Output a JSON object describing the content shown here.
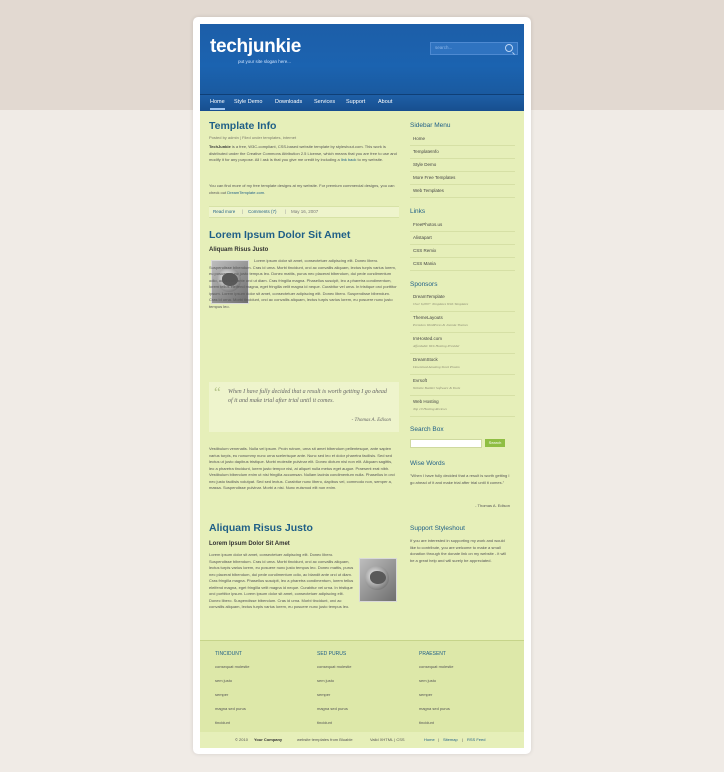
{
  "site": {
    "logo": "techjunkie",
    "slogan": "put your site slogan here...",
    "search_placeholder": "search..."
  },
  "nav": [
    "Home",
    "Style Demo",
    "Downloads",
    "Services",
    "Support",
    "About"
  ],
  "main": {
    "post1": {
      "title": "Template Info",
      "meta": "Posted by admin | Filed under templates, internet",
      "p1_strong": "TechJunkie",
      "p1": " is a free, W3C-compliant, CSS-based website template by styleshout.com. This work is distributed under the Creative Commons Attribution 2.5 License, which means that you are free to use and modify it for any purpose. All I ask is that you give me credit by including a ",
      "p1_link": "link back",
      "p1_end": " to my website.",
      "p2": "You can find more of my free template designs at my website. For premium commercial designs, you can check out ",
      "p2_link": "DreamTemplate.com",
      "p2_end": ".",
      "read_more": "Read more",
      "comments": "Comments (7)",
      "date": "May 16, 2007"
    },
    "post2": {
      "title": "Lorem Ipsum Dolor Sit Amet",
      "subtitle": "Aliquam Risus Justo",
      "text": "Lorem ipsum dolor sit amet, consectetuer adipiscing elit. Donec libero. Suspendisse bibendum. Cras id urna. Morbi tincidunt, orci ac convallis aliquam, lectus turpis varius lorem, eu posuere nunc justo tempus leo. Donec mattis, purus nec placerat bibendum, dui pede condimentum odio, ac blandit ante orci ut diam. Cras fringilla magna. Phasellus suscipit, leo a pharetra condimentum, lorem tellus eleifend magna, eget fringilla velit magna id neque. Curabitur vel urna. In tristique orci porttitor ipsum. Lorem ipsum dolor sit amet, consectetuer adipiscing elit. Donec libero. Suspendisse bibendum. Cras id urna. Morbi tincidunt, orci ac convallis aliquam, lectus turpis varius lorem, eu posuere nunc justo tempus leo.",
      "quote": "When I have fully decided that a result is worth getting I go ahead of it and make trial after trial until it comes.",
      "quote_by": "- Thomas A. Edison",
      "text2": "Vestibulum venenatis. Nulla vel ipsum. Proin rutrum, urna sit amet bibendum pellentesque, ante sapien varius turpis, eu nonummy nunc urna scelerisque ante. Nunc sed leo et dolor pharetra facilisis. Sed sed lectus ut justo dapibus tristique. Morbi molestie pulvinar elit. Donec dictum nisl non elit. Aliquam sagittis, leo a pharetra tincidunt, lorem justo tempor nisi, at aliquet nulla metus eget augue. Praesent erat nibh. Vestibulum bibendum enim ut nisi fringilla accumsan. Nullam lacinia condimentum nulla. Phasellus in orci nec justo facilisis volutpat. Sed sed lectus. Curabitur nunc libero, dapibus vel, commodo non, semper a, massa. Suspendisse pulvinar. Morbi a nisi. Nunc euismod elit non enim."
    },
    "post3": {
      "title": "Aliquam Risus Justo",
      "subtitle": "Lorem Ipsum Dolor Sit Amet",
      "text": "Lorem ipsum dolor sit amet, consectetuer adipiscing elit. Donec libero. Suspendisse bibendum. Cras id urna. Morbi tincidunt, orci ac convallis aliquam, lectus turpis varius lorem, eu posuere nunc justo tempus leo. Donec mattis, purus nec placerat bibendum, dui pede condimentum odio, ac blandit ante orci ut diam. Cras fringilla magna. Phasellus suscipit, leo a pharetra condimentum, lorem tellus eleifend magna, eget fringilla velit magna id neque. Curabitur vel urna. In tristique orci porttitor ipsum. Lorem ipsum dolor sit amet, consectetuer adipiscing elit. Donec libero. Suspendisse bibendum. Cras id urna. Morbi tincidunt, orci ac convallis aliquam, lectus turpis varius lorem, eu posuere nunc justo tempus leo."
    }
  },
  "sidebar": {
    "menu_title": "Sidebar Menu",
    "menu": [
      "Home",
      "TemplateInfo",
      "Style Demo",
      "More Free Templates",
      "Web Templates"
    ],
    "links_title": "Links",
    "links": [
      "FreePhotos.us",
      "Alistapart",
      "CSS Remix",
      "CSS Mania"
    ],
    "sponsors_title": "Sponsors",
    "sponsors": [
      {
        "name": "DreamTemplate",
        "desc": "Over 6,000+ Templates With Templates"
      },
      {
        "name": "ThemeLayouts",
        "desc": "Premium WordPress & Joomla Themes"
      },
      {
        "name": "ImHosted.com",
        "desc": "Affordable Web Hosting Provider"
      },
      {
        "name": "DreamStock",
        "desc": "Download Amazing Stock Photos"
      },
      {
        "name": "Evrsoft",
        "desc": "Website Builder Software & Tools"
      },
      {
        "name": "Web Hosting",
        "desc": "Top 10 Hosting Reviews"
      }
    ],
    "search_title": "Search Box",
    "search_button": "Search",
    "words_title": "Wise Words",
    "words": "\"When I have fully decided that a result is worth getting I go ahead of it and make trial after trial until it comes.\"",
    "words_by": "- Thomas A. Edison",
    "support_title": "Support Styleshout",
    "support_text": "If you are interested in supporting my work and would like to contribute, you are welcome to make a small donation through the donate link on my website - it will be a great help and will surely be appreciated."
  },
  "footer": {
    "cols": [
      {
        "title": "TINCIDUNT",
        "items": [
          "consequat molestie",
          "sem justo",
          "semper",
          "magna sed purus",
          "tincidunt"
        ]
      },
      {
        "title": "SED PURUS",
        "items": [
          "consequat molestie",
          "sem justo",
          "semper",
          "magna sed purus",
          "tincidunt"
        ]
      },
      {
        "title": "PRAESENT",
        "items": [
          "consequat molestie",
          "sem justo",
          "semper",
          "magna sed purus",
          "tincidunt"
        ]
      }
    ],
    "copyright": "© 2010",
    "company": "Your Company",
    "credits": "website templates from Bluable",
    "valid": "Valid XHTML | CSS",
    "home": "Home",
    "sitemap": "Sitemap",
    "rss": "RSS Feed"
  }
}
